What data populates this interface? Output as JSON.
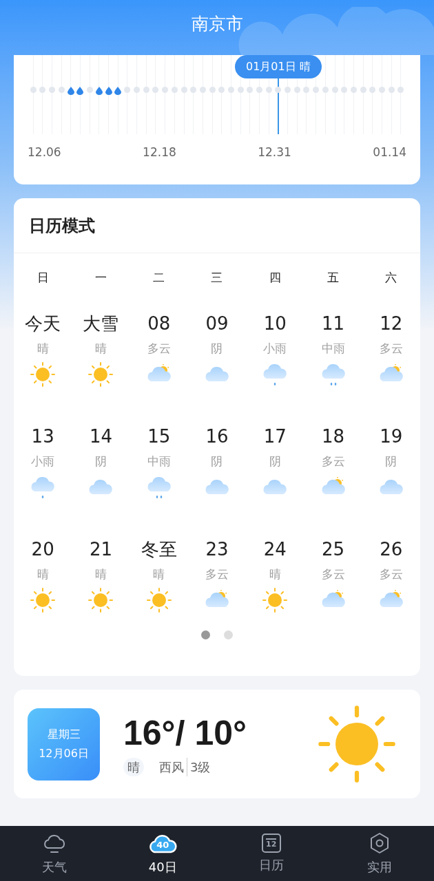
{
  "header": {
    "title": "南京市"
  },
  "timeline": {
    "tooltip": "01月01日 晴",
    "dates": [
      "12.06",
      "12.18",
      "12.31",
      "01.14"
    ],
    "days": [
      {
        "kind": "dry",
        "selected": false
      },
      {
        "kind": "dry",
        "selected": false
      },
      {
        "kind": "dry",
        "selected": false
      },
      {
        "kind": "dry",
        "selected": false
      },
      {
        "kind": "rain",
        "selected": false
      },
      {
        "kind": "rain",
        "selected": false
      },
      {
        "kind": "dry",
        "selected": false
      },
      {
        "kind": "rain",
        "selected": false
      },
      {
        "kind": "rain",
        "selected": false
      },
      {
        "kind": "rain",
        "selected": false
      },
      {
        "kind": "dry",
        "selected": false
      },
      {
        "kind": "dry",
        "selected": false
      },
      {
        "kind": "dry",
        "selected": false
      },
      {
        "kind": "dry",
        "selected": false
      },
      {
        "kind": "dry",
        "selected": false
      },
      {
        "kind": "dry",
        "selected": false
      },
      {
        "kind": "dry",
        "selected": false
      },
      {
        "kind": "dry",
        "selected": false
      },
      {
        "kind": "dry",
        "selected": false
      },
      {
        "kind": "dry",
        "selected": false
      },
      {
        "kind": "dry",
        "selected": false
      },
      {
        "kind": "dry",
        "selected": false
      },
      {
        "kind": "dry",
        "selected": false
      },
      {
        "kind": "dry",
        "selected": false
      },
      {
        "kind": "dry",
        "selected": false
      },
      {
        "kind": "dry",
        "selected": false
      },
      {
        "kind": "dry",
        "selected": true
      },
      {
        "kind": "dry",
        "selected": false
      },
      {
        "kind": "dry",
        "selected": false
      },
      {
        "kind": "dry",
        "selected": false
      },
      {
        "kind": "dry",
        "selected": false
      },
      {
        "kind": "dry",
        "selected": false
      },
      {
        "kind": "dry",
        "selected": false
      },
      {
        "kind": "dry",
        "selected": false
      },
      {
        "kind": "dry",
        "selected": false
      },
      {
        "kind": "dry",
        "selected": false
      },
      {
        "kind": "dry",
        "selected": false
      },
      {
        "kind": "dry",
        "selected": false
      },
      {
        "kind": "dry",
        "selected": false
      },
      {
        "kind": "dry",
        "selected": false
      }
    ]
  },
  "calendar": {
    "title": "日历模式",
    "weekdays": [
      "日",
      "一",
      "二",
      "三",
      "四",
      "五",
      "六"
    ],
    "weeks": [
      [
        {
          "label": "今天",
          "weather": "晴",
          "kind": "sun"
        },
        {
          "label": "大雪",
          "weather": "晴",
          "kind": "sun"
        },
        {
          "label": "08",
          "weather": "多云",
          "kind": "partly"
        },
        {
          "label": "09",
          "weather": "阴",
          "kind": "cloud"
        },
        {
          "label": "10",
          "weather": "小雨",
          "kind": "light_rain"
        },
        {
          "label": "11",
          "weather": "中雨",
          "kind": "rain"
        },
        {
          "label": "12",
          "weather": "多云",
          "kind": "partly"
        }
      ],
      [
        {
          "label": "13",
          "weather": "小雨",
          "kind": "light_rain"
        },
        {
          "label": "14",
          "weather": "阴",
          "kind": "cloud"
        },
        {
          "label": "15",
          "weather": "中雨",
          "kind": "rain"
        },
        {
          "label": "16",
          "weather": "阴",
          "kind": "cloud"
        },
        {
          "label": "17",
          "weather": "阴",
          "kind": "cloud"
        },
        {
          "label": "18",
          "weather": "多云",
          "kind": "partly"
        },
        {
          "label": "19",
          "weather": "阴",
          "kind": "cloud"
        }
      ],
      [
        {
          "label": "20",
          "weather": "晴",
          "kind": "sun"
        },
        {
          "label": "21",
          "weather": "晴",
          "kind": "sun"
        },
        {
          "label": "冬至",
          "weather": "晴",
          "kind": "sun"
        },
        {
          "label": "23",
          "weather": "多云",
          "kind": "partly"
        },
        {
          "label": "24",
          "weather": "晴",
          "kind": "sun"
        },
        {
          "label": "25",
          "weather": "多云",
          "kind": "partly"
        },
        {
          "label": "26",
          "weather": "多云",
          "kind": "partly"
        }
      ]
    ],
    "pages": [
      {
        "selected": true
      },
      {
        "selected": false
      }
    ]
  },
  "today": {
    "weekday": "星期三",
    "date": "12月06日",
    "temperature": "16°/ 10°",
    "weather": "晴",
    "wind": "西风",
    "wind_level": "3级",
    "kind": "sun"
  },
  "tabs": [
    {
      "label": "天气",
      "kind": "cloud",
      "selected": false
    },
    {
      "label": "40日",
      "kind": "cloud40",
      "icon_text": "40",
      "selected": true
    },
    {
      "label": "日历",
      "kind": "calendar",
      "icon_text": "12",
      "selected": false
    },
    {
      "label": "实用",
      "kind": "hexagon",
      "selected": false
    }
  ]
}
